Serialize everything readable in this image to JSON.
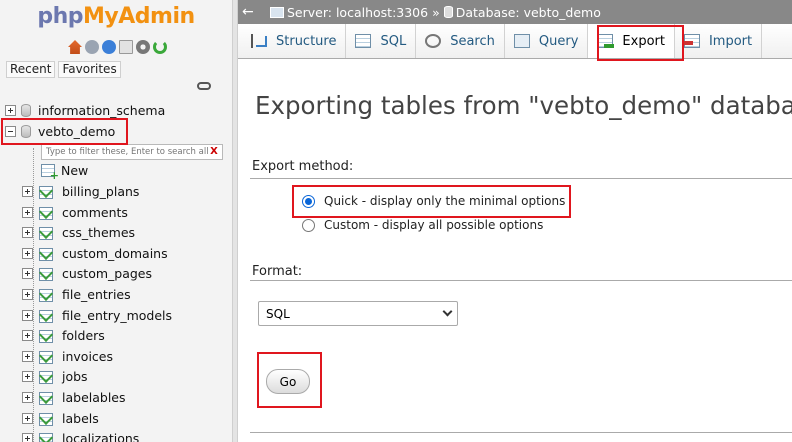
{
  "nav": {
    "logo": {
      "php": "php",
      "myadmin": "MyAdmin"
    },
    "icons": [
      "home-icon",
      "logout-icon",
      "help-icon",
      "docs-icon",
      "settings-gear-icon",
      "reload-icon"
    ],
    "tabs": {
      "recent": "Recent",
      "favorites": "Favorites"
    },
    "tree": {
      "db_other": "information_schema",
      "db_current": "vebto_demo",
      "filter_placeholder": "Type to filter these, Enter to search all",
      "filter_clear": "X",
      "new_label": "New",
      "tables": [
        "billing_plans",
        "comments",
        "css_themes",
        "custom_domains",
        "custom_pages",
        "file_entries",
        "file_entry_models",
        "folders",
        "invoices",
        "jobs",
        "labelables",
        "labels",
        "localizations"
      ]
    }
  },
  "topbar": {
    "server": "Server: localhost:3306",
    "separator": "»",
    "database": "Database: vebto_demo"
  },
  "tabs": [
    {
      "label": "Structure",
      "icon": "structure-icon"
    },
    {
      "label": "SQL",
      "icon": "sql-icon"
    },
    {
      "label": "Search",
      "icon": "search-icon"
    },
    {
      "label": "Query",
      "icon": "query-icon"
    },
    {
      "label": "Export",
      "icon": "export-icon",
      "active": true
    },
    {
      "label": "Import",
      "icon": "import-icon"
    }
  ],
  "main": {
    "title": "Exporting tables from \"vebto_demo\" database",
    "export_method": {
      "legend": "Export method:",
      "options": [
        {
          "label": "Quick - display only the minimal options",
          "checked": true
        },
        {
          "label": "Custom - display all possible options",
          "checked": false
        }
      ]
    },
    "format": {
      "legend": "Format:",
      "selected": "SQL"
    },
    "go_label": "Go"
  },
  "colors": {
    "highlight": "#e0161e",
    "topbar": "#888888",
    "link": "#235a81",
    "radio_checked": "#0a66d8"
  }
}
